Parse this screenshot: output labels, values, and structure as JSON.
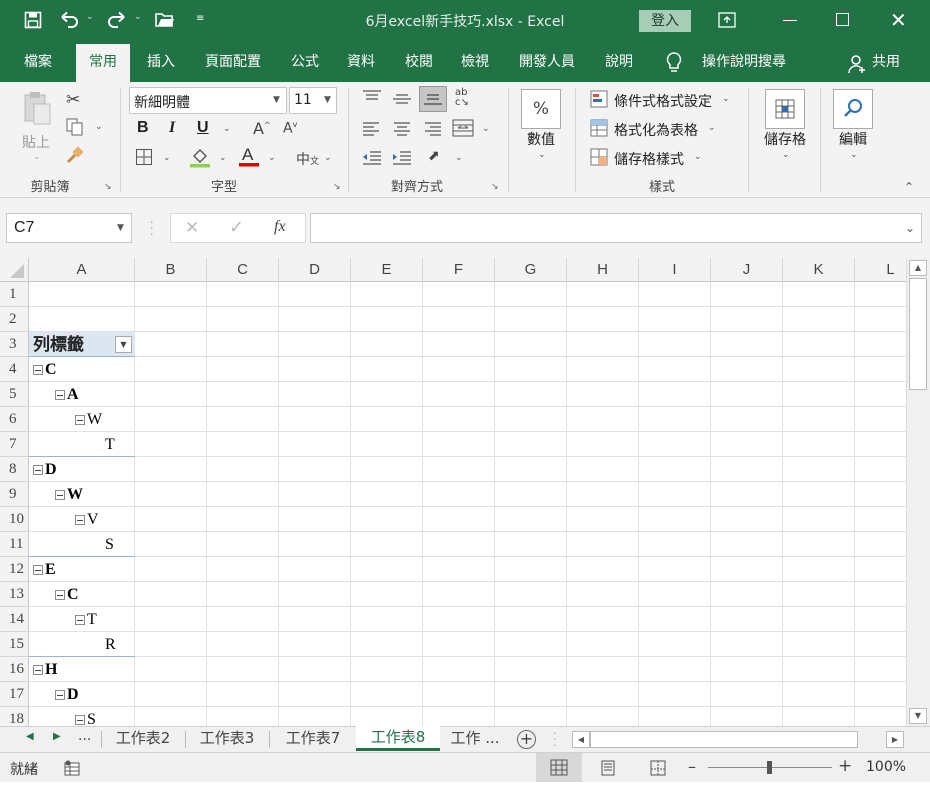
{
  "window": {
    "title": "6月excel新手技巧.xlsx  -  Excel",
    "signin_label": "登入",
    "share_label": "共用"
  },
  "ribbon_tabs": [
    "檔案",
    "常用",
    "插入",
    "頁面配置",
    "公式",
    "資料",
    "校閱",
    "檢視",
    "開發人員",
    "說明",
    "操作說明搜尋"
  ],
  "ribbon": {
    "clipboard": {
      "paste_label": "貼上",
      "group_label": "剪貼簿"
    },
    "font": {
      "font_name": "新細明體",
      "font_size": "11",
      "bold": "B",
      "italic": "I",
      "underline": "U",
      "group_label": "字型"
    },
    "alignment": {
      "group_label": "對齊方式"
    },
    "number": {
      "symbol": "%",
      "label": "數值"
    },
    "styles": {
      "conditional": "條件式格式設定",
      "as_table": "格式化為表格",
      "cell_styles": "儲存格樣式",
      "group_label": "樣式"
    },
    "cells": {
      "label": "儲存格"
    },
    "editing": {
      "label": "編輯"
    }
  },
  "formula_bar": {
    "name_box": "C7",
    "fx": "fx",
    "formula": ""
  },
  "columns": [
    "A",
    "B",
    "C",
    "D",
    "E",
    "F",
    "G",
    "H",
    "I",
    "J",
    "K",
    "L"
  ],
  "rows": [
    "1",
    "2",
    "3",
    "4",
    "5",
    "6",
    "7",
    "8",
    "9",
    "10",
    "11",
    "12",
    "13",
    "14",
    "15",
    "16",
    "17",
    "18"
  ],
  "pivot": {
    "header": "列標籤",
    "items": [
      {
        "row": "4",
        "level": 0,
        "text": "C",
        "bold": true,
        "collapse": true
      },
      {
        "row": "5",
        "level": 1,
        "text": "A",
        "bold": true,
        "collapse": true
      },
      {
        "row": "6",
        "level": 2,
        "text": "W",
        "bold": false,
        "collapse": true
      },
      {
        "row": "7",
        "level": 3,
        "text": "T",
        "bold": false,
        "collapse": false
      },
      {
        "row": "8",
        "level": 0,
        "text": "D",
        "bold": true,
        "collapse": true
      },
      {
        "row": "9",
        "level": 1,
        "text": "W",
        "bold": true,
        "collapse": true
      },
      {
        "row": "10",
        "level": 2,
        "text": "V",
        "bold": false,
        "collapse": true
      },
      {
        "row": "11",
        "level": 3,
        "text": "S",
        "bold": false,
        "collapse": false
      },
      {
        "row": "12",
        "level": 0,
        "text": "E",
        "bold": true,
        "collapse": true
      },
      {
        "row": "13",
        "level": 1,
        "text": "C",
        "bold": true,
        "collapse": true
      },
      {
        "row": "14",
        "level": 2,
        "text": "T",
        "bold": false,
        "collapse": true
      },
      {
        "row": "15",
        "level": 3,
        "text": "R",
        "bold": false,
        "collapse": false
      },
      {
        "row": "16",
        "level": 0,
        "text": "H",
        "bold": true,
        "collapse": true
      },
      {
        "row": "17",
        "level": 1,
        "text": "D",
        "bold": true,
        "collapse": true
      },
      {
        "row": "18",
        "level": 2,
        "text": "S",
        "bold": false,
        "collapse": true
      }
    ]
  },
  "sheet_tabs": [
    "工作表2",
    "工作表3",
    "工作表7",
    "工作表8",
    "工作 ..."
  ],
  "active_sheet": "工作表8",
  "sheet_nav_more": "...",
  "status": {
    "ready": "就緒",
    "zoom": "100%"
  },
  "colors": {
    "excel_green": "#217346",
    "selection": "#107c41"
  }
}
